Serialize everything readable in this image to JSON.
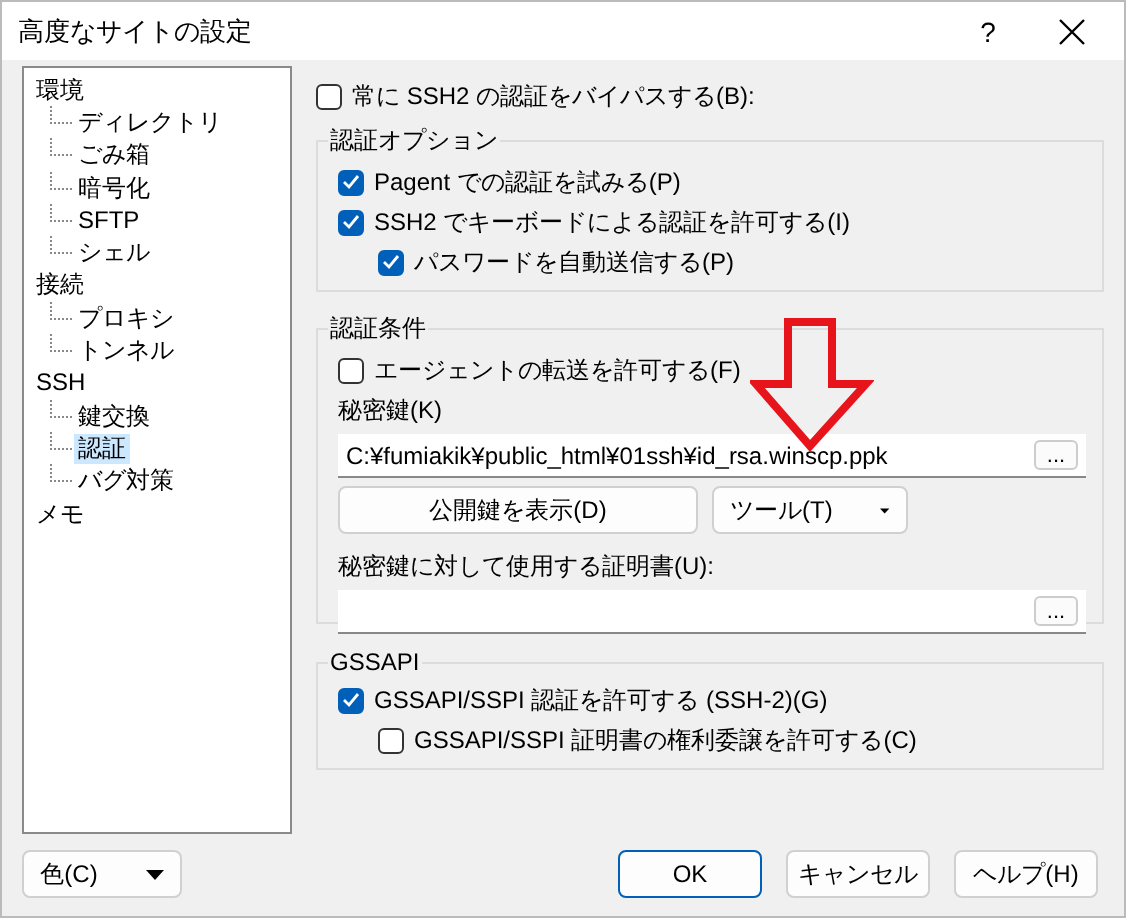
{
  "window": {
    "title": "高度なサイトの設定",
    "help_button": "?"
  },
  "tree": [
    {
      "label": "環境",
      "selected": false,
      "children": [
        {
          "label": "ディレクトリ",
          "selected": false
        },
        {
          "label": "ごみ箱",
          "selected": false
        },
        {
          "label": "暗号化",
          "selected": false
        },
        {
          "label": "SFTP",
          "selected": false
        },
        {
          "label": "シェル",
          "selected": false
        }
      ]
    },
    {
      "label": "接続",
      "selected": false,
      "children": [
        {
          "label": "プロキシ",
          "selected": false
        },
        {
          "label": "トンネル",
          "selected": false
        }
      ]
    },
    {
      "label": "SSH",
      "selected": false,
      "children": [
        {
          "label": "鍵交換",
          "selected": false
        },
        {
          "label": "認証",
          "selected": true
        },
        {
          "label": "バグ対策",
          "selected": false
        }
      ]
    },
    {
      "label": "メモ",
      "selected": false
    }
  ],
  "bypass": {
    "label": "常に SSH2 の認証をバイパスする(B):",
    "checked": false
  },
  "auth_options": {
    "title": "認証オプション",
    "options": [
      {
        "label": "Pagent での認証を試みる(P)",
        "checked": true
      },
      {
        "label": "SSH2 でキーボードによる認証を許可する(I)",
        "checked": true,
        "children": [
          {
            "label": "パスワードを自動送信する(P)",
            "checked": true
          }
        ]
      }
    ]
  },
  "auth_conditions": {
    "title": "認証条件",
    "agent_forwarding": {
      "label": "エージェントの転送を許可する(F)",
      "checked": false
    },
    "private_key": {
      "label": "秘密鍵(K)",
      "value": "C:¥fumiakik¥public_html¥01ssh¥id_rsa.winscp.ppk",
      "browse_button": "..."
    },
    "show_public_key_button": "公開鍵を表示(D)",
    "tools_button": "ツール(T)",
    "certificate": {
      "label": "秘密鍵に対して使用する証明書(U):",
      "browse_button": "..."
    }
  },
  "gssapi": {
    "title": "GSSAPI",
    "options": [
      {
        "label": "GSSAPI/SSPI 認証を許可する (SSH-2)(G)",
        "checked": true,
        "children": [
          {
            "label": "GSSAPI/SSPI 証明書の権利委譲を許可する(C)",
            "checked": false
          }
        ]
      }
    ]
  },
  "color_button": "色(C)",
  "buttons": [
    {
      "label": "OK",
      "default": true
    },
    {
      "label": "キャンセル",
      "default": false
    },
    {
      "label": "ヘルプ(H)",
      "default": false
    }
  ]
}
